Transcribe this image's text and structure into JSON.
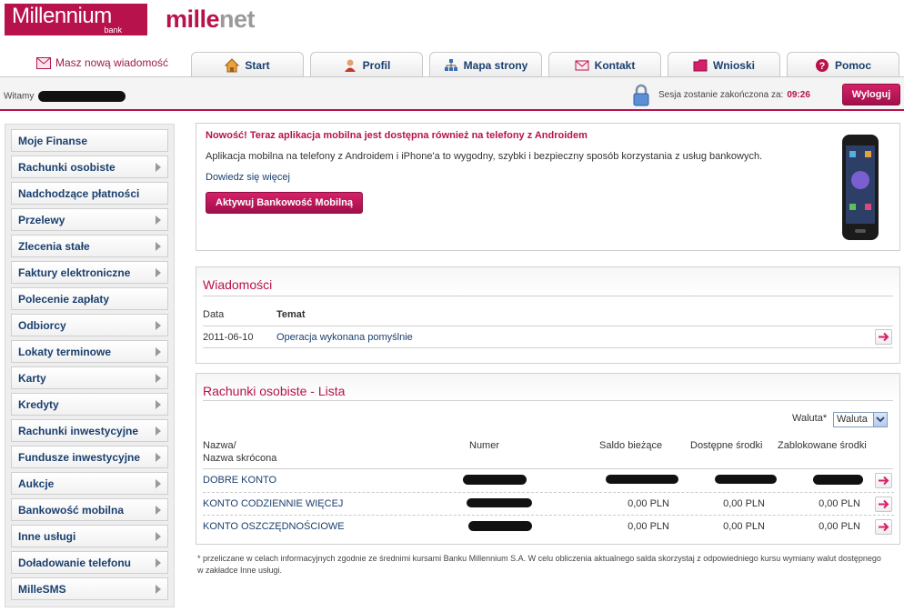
{
  "header": {
    "logo_main": "Millennium",
    "logo_sub": "bank",
    "brand_part1": "mille",
    "brand_part2": "net"
  },
  "nav": {
    "new_message_label": "Masz nową wiadomość",
    "tabs": [
      {
        "label": "Start",
        "icon": "home-icon"
      },
      {
        "label": "Profil",
        "icon": "user-icon"
      },
      {
        "label": "Mapa strony",
        "icon": "sitemap-icon"
      },
      {
        "label": "Kontakt",
        "icon": "envelope-icon"
      },
      {
        "label": "Wnioski",
        "icon": "folder-icon"
      },
      {
        "label": "Pomoc",
        "icon": "help-icon"
      }
    ]
  },
  "topbar": {
    "welcome": "Witamy",
    "session_label": "Sesja zostanie zakończona za:",
    "session_time": "09:26",
    "logout_label": "Wyloguj"
  },
  "sidebar": {
    "items": [
      {
        "label": "Moje Finanse",
        "arrow": false
      },
      {
        "label": "Rachunki osobiste",
        "arrow": true
      },
      {
        "label": "Nadchodzące płatności",
        "arrow": false
      },
      {
        "label": "Przelewy",
        "arrow": true
      },
      {
        "label": "Zlecenia stałe",
        "arrow": true
      },
      {
        "label": "Faktury elektroniczne",
        "arrow": true
      },
      {
        "label": "Polecenie zapłaty",
        "arrow": false
      },
      {
        "label": "Odbiorcy",
        "arrow": true
      },
      {
        "label": "Lokaty terminowe",
        "arrow": true
      },
      {
        "label": "Karty",
        "arrow": true
      },
      {
        "label": "Kredyty",
        "arrow": true
      },
      {
        "label": "Rachunki inwestycyjne",
        "arrow": true
      },
      {
        "label": "Fundusze inwestycyjne",
        "arrow": true
      },
      {
        "label": "Aukcje",
        "arrow": true
      },
      {
        "label": "Bankowość mobilna",
        "arrow": true
      },
      {
        "label": "Inne usługi",
        "arrow": true
      },
      {
        "label": "Doładowanie telefonu",
        "arrow": true
      },
      {
        "label": "MilleSMS",
        "arrow": true
      }
    ]
  },
  "promo": {
    "title": "Nowość! Teraz aplikacja mobilna jest dostępna również na telefony z Androidem",
    "text": "Aplikacja mobilna na telefony z Androidem i iPhone'a to wygodny, szybki i bezpieczny sposób korzystania z usług bankowych.",
    "more_link": "Dowiedz się więcej",
    "button_label": "Aktywuj Bankowość Mobilną"
  },
  "messages": {
    "title": "Wiadomości",
    "col_date": "Data",
    "col_subject": "Temat",
    "rows": [
      {
        "date": "2011-06-10",
        "subject": "Operacja wykonana pomyślnie"
      }
    ]
  },
  "accounts": {
    "title": "Rachunki osobiste - Lista",
    "currency_label": "Waluta*",
    "currency_value": "Waluta",
    "col_name_1": "Nazwa/",
    "col_name_2": "Nazwa skrócona",
    "col_number": "Numer",
    "col_balance": "Saldo bieżące",
    "col_available": "Dostępne środki",
    "col_blocked": "Zablokowane środki",
    "rows": [
      {
        "name": "DOBRE KONTO",
        "balance": "",
        "available": "",
        "blocked": ""
      },
      {
        "name": "KONTO CODZIENNIE WIĘCEJ",
        "balance": "0,00 PLN",
        "available": "0,00 PLN",
        "blocked": "0,00 PLN"
      },
      {
        "name": "KONTO OSZCZĘDNOŚCIOWE",
        "balance": "0,00 PLN",
        "available": "0,00 PLN",
        "blocked": "0,00 PLN"
      }
    ],
    "footnote": "* przeliczane w celach informacyjnych zgodnie ze średnimi kursami Banku Millennium S.A. W celu obliczenia aktualnego salda skorzystaj z odpowiedniego kursu wymiany walut dostępnego w zakładce Inne usługi."
  },
  "colors": {
    "brand": "#b8124d",
    "link": "#1a3f6e"
  }
}
